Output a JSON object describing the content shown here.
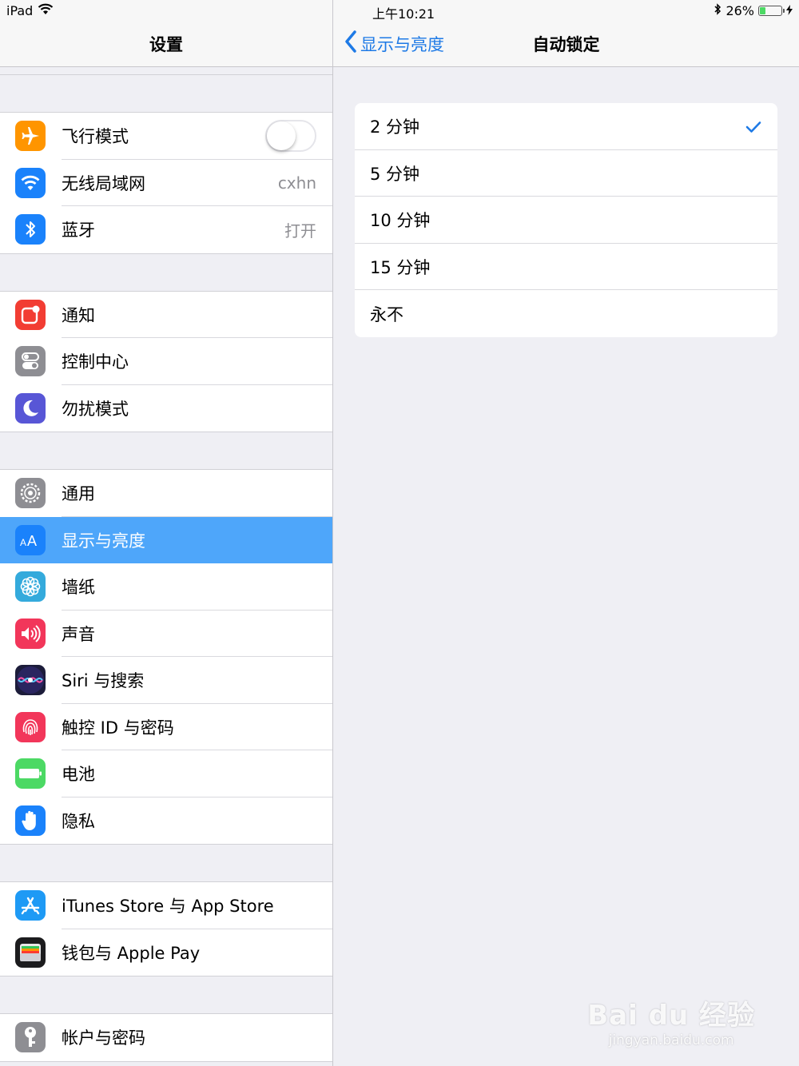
{
  "status_bar": {
    "device": "iPad",
    "time": "上午10:21",
    "battery_percent": "26%",
    "battery_level": 0.26
  },
  "master": {
    "title": "设置",
    "groups": [
      [
        {
          "label": "飞行模式",
          "icon": "airplane-icon",
          "color": "#ff9500",
          "toggle": false
        },
        {
          "label": "无线局域网",
          "icon": "wifi-icon",
          "color": "#1a82fb",
          "value": "cxhn"
        },
        {
          "label": "蓝牙",
          "icon": "bluetooth-icon",
          "color": "#1a82fb",
          "value": "打开"
        }
      ],
      [
        {
          "label": "通知",
          "icon": "notifications-icon",
          "color": "#f23d33"
        },
        {
          "label": "控制中心",
          "icon": "control-center-icon",
          "color": "#8e8e93"
        },
        {
          "label": "勿扰模式",
          "icon": "moon-icon",
          "color": "#5856d6"
        }
      ],
      [
        {
          "label": "通用",
          "icon": "gear-icon",
          "color": "#8e8e93"
        },
        {
          "label": "显示与亮度",
          "icon": "display-brightness-icon",
          "color": "#1a82fb",
          "selected": true
        },
        {
          "label": "墙纸",
          "icon": "wallpaper-flower-icon",
          "color": "#34aadc"
        },
        {
          "label": "声音",
          "icon": "speaker-icon",
          "color": "#f2365a"
        },
        {
          "label": "Siri 与搜索",
          "icon": "siri-icon",
          "color": "#1c1c3a"
        },
        {
          "label": "触控 ID 与密码",
          "icon": "fingerprint-icon",
          "color": "#f2365a"
        },
        {
          "label": "电池",
          "icon": "battery-icon",
          "color": "#4cd964"
        },
        {
          "label": "隐私",
          "icon": "hand-icon",
          "color": "#1a82fb"
        }
      ],
      [
        {
          "label": "iTunes Store 与 App Store",
          "icon": "app-store-icon",
          "color": "#1e9af5"
        },
        {
          "label": "钱包与 Apple Pay",
          "icon": "wallet-icon",
          "color": "#1c1c1e"
        }
      ],
      [
        {
          "label": "帐户与密码",
          "icon": "key-icon",
          "color": "#8e8e93"
        }
      ]
    ]
  },
  "detail": {
    "back_label": "显示与亮度",
    "title": "自动锁定",
    "options": [
      {
        "label": "2 分钟",
        "checked": true
      },
      {
        "label": "5 分钟",
        "checked": false
      },
      {
        "label": "10 分钟",
        "checked": false
      },
      {
        "label": "15 分钟",
        "checked": false
      },
      {
        "label": "永不",
        "checked": false
      }
    ]
  },
  "watermark": {
    "logo": "Bai du 经验",
    "url": "jingyan.baidu.com"
  },
  "colors": {
    "accent": "#1e7ae6",
    "selected_row": "#4ea6fa",
    "background": "#efeff4"
  }
}
